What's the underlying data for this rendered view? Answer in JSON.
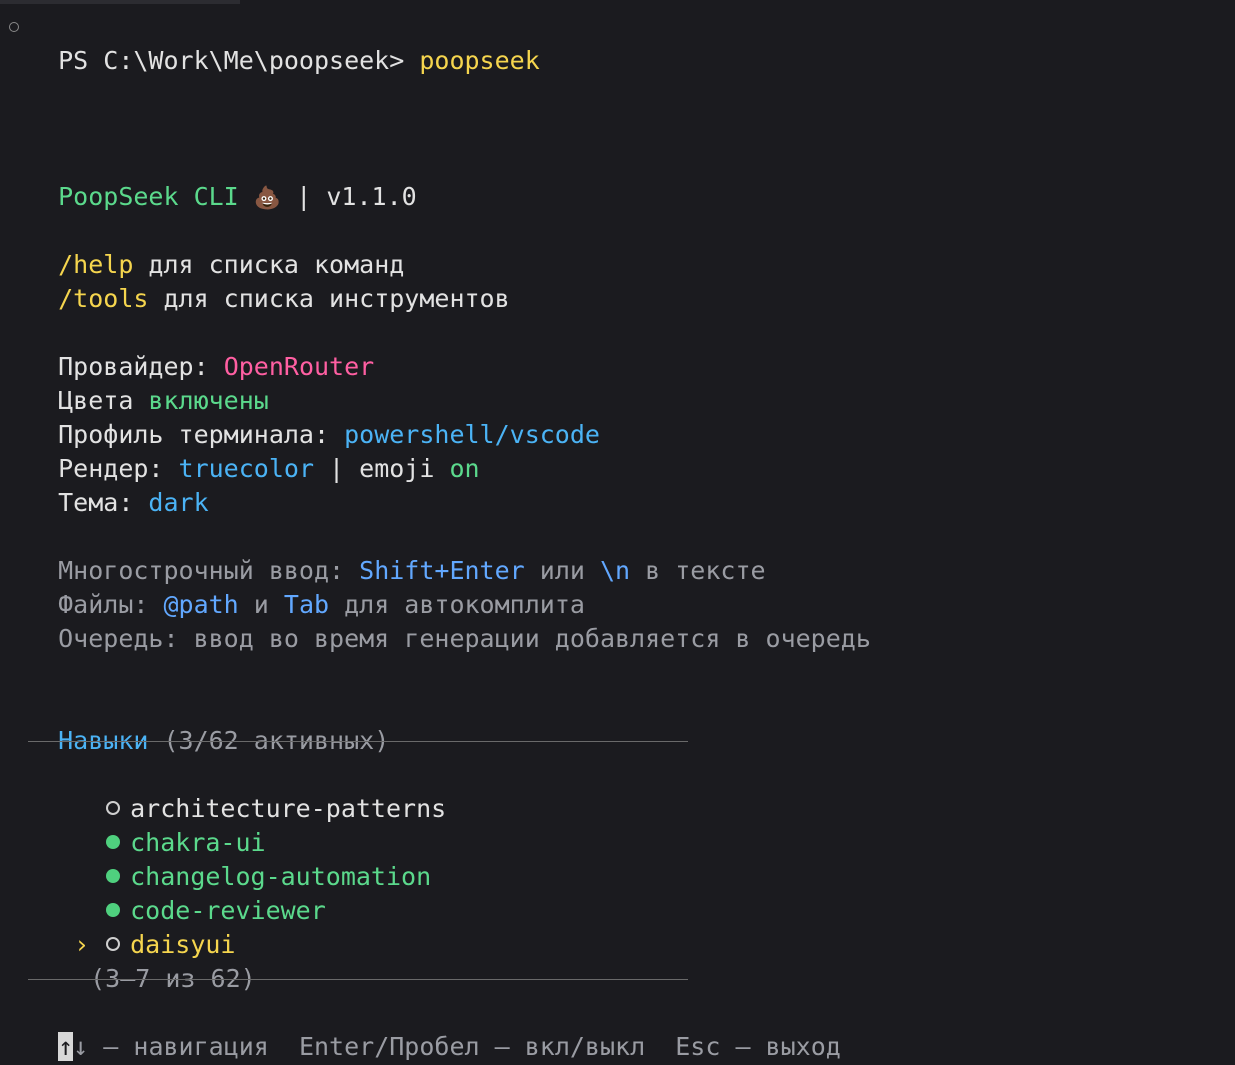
{
  "terminal": {
    "prompt": "PS C:\\Work\\Me\\poopseek> ",
    "command": "poopseek"
  },
  "banner": {
    "app_name": "PoopSeek CLI",
    "emoji": "💩",
    "separator": " | ",
    "version": "v1.1.0"
  },
  "hints": [
    {
      "cmd": "/help",
      "text": " для списка команд"
    },
    {
      "cmd": "/tools",
      "text": " для списка инструментов"
    }
  ],
  "status": {
    "provider_label": "Провайдер: ",
    "provider_value": "OpenRouter",
    "colors_label": "Цвета ",
    "colors_value": "включены",
    "profile_label": "Профиль терминала: ",
    "profile_value": "powershell/vscode",
    "render_label": "Рендер: ",
    "render_value": "truecolor",
    "render_sep": " | ",
    "render_emoji": "emoji ",
    "render_emoji_value": "on",
    "theme_label": "Тема: ",
    "theme_value": "dark"
  },
  "tips": {
    "multiline_label": "Многострочный ввод: ",
    "multiline_key": "Shift+Enter",
    "multiline_or": " или ",
    "multiline_newline": "\\n",
    "multiline_suffix": " в тексте",
    "files_label": "Файлы: ",
    "files_path": "@path",
    "files_and": " и ",
    "files_tab": "Tab",
    "files_suffix": " для автокомплита",
    "queue_text": "Очередь: ввод во время генерации добавляется в очередь"
  },
  "skills": {
    "title": "Навыки",
    "count": " (3/62 активных)",
    "items": [
      {
        "name": "architecture-patterns",
        "active": false,
        "selected": false
      },
      {
        "name": "chakra-ui",
        "active": true,
        "selected": false
      },
      {
        "name": "changelog-automation",
        "active": true,
        "selected": false
      },
      {
        "name": "code-reviewer",
        "active": true,
        "selected": false
      },
      {
        "name": "daisyui",
        "active": false,
        "selected": true
      }
    ],
    "cursor_glyph": "›",
    "pagination": "(3–7 из 62)"
  },
  "footer": {
    "arrow_up": "↑",
    "arrow_down": "↓",
    "nav_text": " — навигация  ",
    "toggle_text": "Enter/Пробел — вкл/выкл  ",
    "exit_text": "Esc — выход"
  },
  "colors": {
    "background": "#1b1b1f",
    "green": "#5bd98c",
    "yellow": "#f5d54e",
    "pink": "#ff5fa2",
    "blue": "#4bb3f5"
  }
}
